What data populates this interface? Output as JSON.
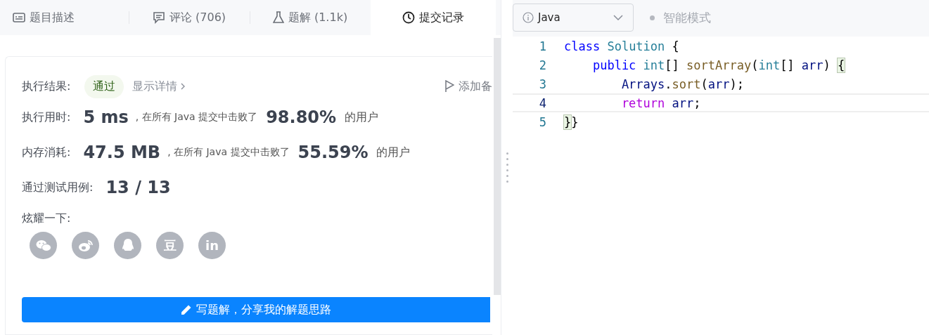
{
  "tabs": [
    {
      "kind": "description",
      "label": "题目描述",
      "selected": false
    },
    {
      "kind": "comments",
      "label": "评论 (706)",
      "selected": false
    },
    {
      "kind": "solutions",
      "label": "题解 (1.1k)",
      "selected": false
    },
    {
      "kind": "submissions",
      "label": "提交记录",
      "selected": true
    }
  ],
  "result": {
    "label": "执行结果:",
    "status": "通过",
    "details_link": "显示详情",
    "add_note": "添加备"
  },
  "metrics": [
    {
      "label": "执行用时:",
      "value": "5 ms",
      "middle": ", 在所有 Java 提交中击败了",
      "percent": "98.80%",
      "suffix": "的用户"
    },
    {
      "label": "内存消耗:",
      "value": "47.5 MB",
      "middle": ", 在所有 Java 提交中击败了",
      "percent": "55.59%",
      "suffix": "的用户"
    },
    {
      "label": "通过测试用例:",
      "value": "13 / 13"
    }
  ],
  "share": {
    "label": "炫耀一下:",
    "icons": [
      {
        "kind": "wechat"
      },
      {
        "kind": "weibo"
      },
      {
        "kind": "qq"
      },
      {
        "kind": "douban",
        "glyph": "豆"
      },
      {
        "kind": "linkedin",
        "glyph": "in"
      }
    ]
  },
  "write_button": "写题解，分享我的解题思路",
  "editor": {
    "language": "Java",
    "mode": "智能模式",
    "lines": [
      {
        "number": "1",
        "current": false,
        "tokens": [
          {
            "kind": "keyword",
            "text": "class"
          },
          {
            "kind": "type",
            "text": " Solution"
          },
          {
            "kind": "punct",
            "text": " {",
            "matched": false
          }
        ]
      },
      {
        "number": "2",
        "current": false,
        "tokens": [
          {
            "kind": "keyword",
            "text": "    public"
          },
          {
            "kind": "type",
            "text": " int"
          },
          {
            "kind": "punct",
            "text": "[]"
          },
          {
            "kind": "method",
            "text": " sortArray"
          },
          {
            "kind": "punct",
            "text": "("
          },
          {
            "kind": "type",
            "text": "int"
          },
          {
            "kind": "punct",
            "text": "[]"
          },
          {
            "kind": "variable",
            "text": " arr"
          },
          {
            "kind": "punct",
            "text": ") "
          },
          {
            "kind": "punct",
            "text": "{",
            "matched": true
          }
        ]
      },
      {
        "number": "3",
        "current": false,
        "tokens": [
          {
            "kind": "variable",
            "text": "        Arrays"
          },
          {
            "kind": "punct",
            "text": "."
          },
          {
            "kind": "method",
            "text": "sort"
          },
          {
            "kind": "punct",
            "text": "("
          },
          {
            "kind": "variable",
            "text": "arr"
          },
          {
            "kind": "punct",
            "text": ");"
          }
        ]
      },
      {
        "number": "4",
        "current": true,
        "tokens": [
          {
            "kind": "control",
            "text": "        return"
          },
          {
            "kind": "variable",
            "text": " arr"
          },
          {
            "kind": "punct",
            "text": ";"
          }
        ]
      },
      {
        "number": "5",
        "current": false,
        "tokens": [
          {
            "kind": "punct",
            "text": "}",
            "matched": true
          },
          {
            "kind": "punct",
            "text": "}"
          }
        ]
      }
    ]
  }
}
